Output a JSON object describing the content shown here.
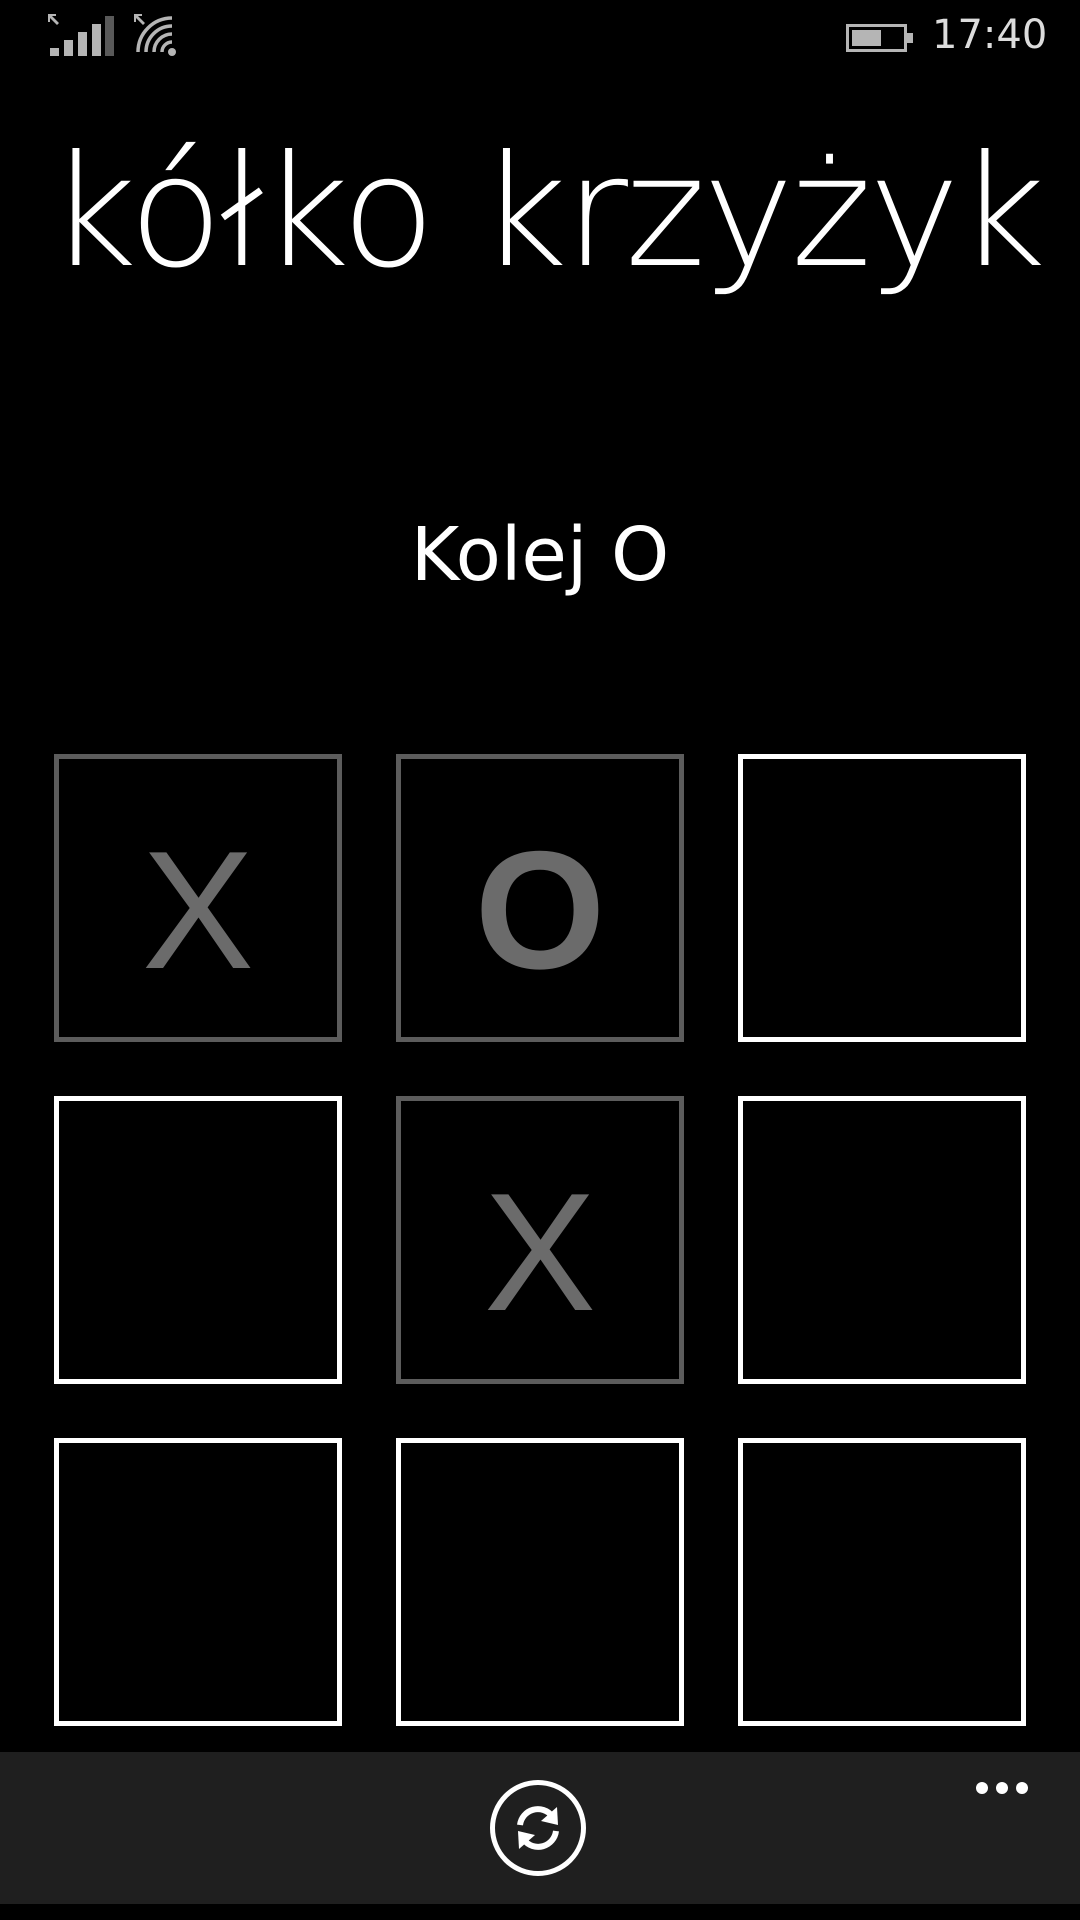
{
  "status_bar": {
    "time": "17:40",
    "icons": [
      "signal-icon",
      "wifi-icon",
      "battery-icon"
    ],
    "battery_level": 0.6
  },
  "app": {
    "title": "kółko krzyżyk",
    "turn_text": "Kolej O"
  },
  "board": {
    "cells": [
      {
        "value": "X",
        "state": "taken"
      },
      {
        "value": "O",
        "state": "taken"
      },
      {
        "value": "",
        "state": "empty"
      },
      {
        "value": "",
        "state": "empty"
      },
      {
        "value": "X",
        "state": "taken"
      },
      {
        "value": "",
        "state": "empty"
      },
      {
        "value": "",
        "state": "empty"
      },
      {
        "value": "",
        "state": "empty"
      },
      {
        "value": "",
        "state": "empty"
      }
    ]
  },
  "app_bar": {
    "buttons": [
      "refresh-icon",
      "more-icon"
    ]
  },
  "colors": {
    "background": "#000000",
    "text": "#ffffff",
    "empty_cell_border": "#ffffff",
    "taken_cell_border": "#5c5c5c",
    "mark": "#6b6b6b",
    "app_bar": "#1f1f1f"
  }
}
